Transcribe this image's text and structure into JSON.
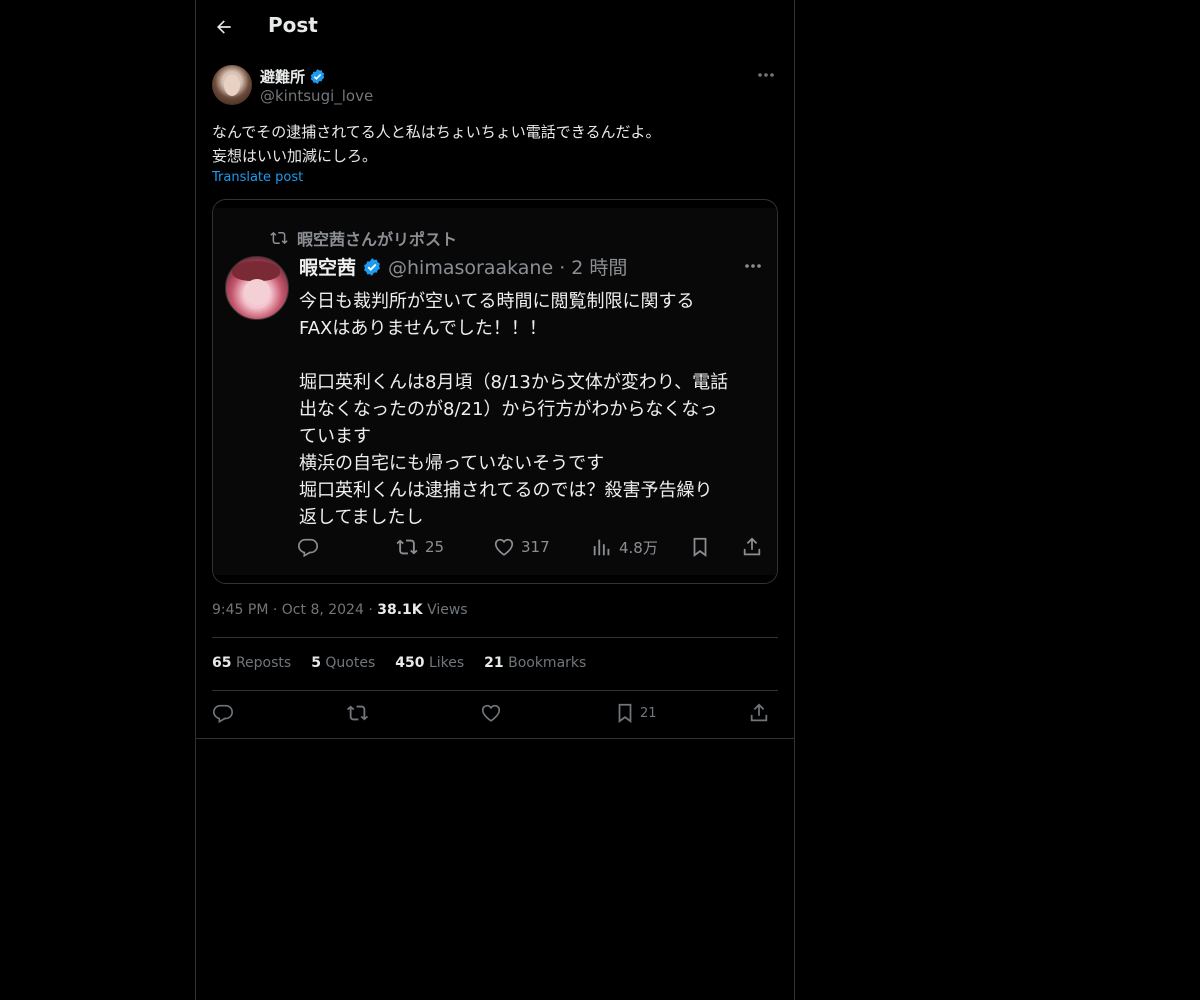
{
  "header": {
    "title": "Post"
  },
  "post": {
    "author": {
      "display_name": "避難所",
      "handle": "@kintsugi_love",
      "verified": true
    },
    "text": "なんでその逮捕されてる人と私はちょいちょい電話できるんだよ。\n妄想はいい加減にしろ。",
    "translate_label": "Translate post",
    "time": "9:45 PM",
    "date": "Oct 8, 2024",
    "views_count": "38.1K",
    "views_label": "Views"
  },
  "quoted": {
    "repost_line": "暇空茜さんがリポスト",
    "display_name": "暇空茜",
    "handle_time": "@himasoraakane · 2 時間",
    "body": "今日も裁判所が空いてる時間に閲覧制限に関する\nFAXはありませんでした！！！\n\n堀口英利くんは8月頃（8/13から文体が変わり、電話\n出なくなったのが8/21）から行方がわからなくなっ\nています\n横浜の自宅にも帰っていないそうです\n堀口英利くんは逮捕されてるのでは？殺害予告繰り\n返してましたし",
    "reposts": "25",
    "likes": "317",
    "views": "4.8万"
  },
  "stats": {
    "reposts_count": "65",
    "reposts_label": "Reposts",
    "quotes_count": "5",
    "quotes_label": "Quotes",
    "likes_count": "450",
    "likes_label": "Likes",
    "bookmarks_count": "21",
    "bookmarks_label": "Bookmarks"
  },
  "actions": {
    "bookmark_count": "21"
  },
  "colors": {
    "background": "#000000",
    "border": "#2f3336",
    "muted": "#71767b",
    "link": "#1d9bf0",
    "verified": "#1d9bf0"
  },
  "icons": [
    "back-arrow-icon",
    "verified-badge-icon",
    "more-icon",
    "reply-icon",
    "repost-icon",
    "like-icon",
    "views-icon",
    "bookmark-icon",
    "share-icon"
  ]
}
